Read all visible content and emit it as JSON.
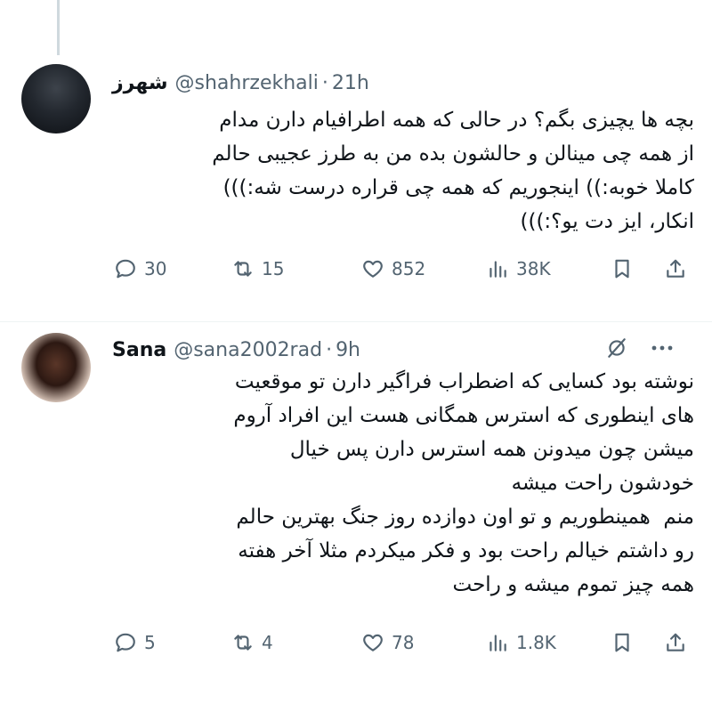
{
  "tweets": [
    {
      "name": "شهرز",
      "handle": "@shahrzekhali",
      "time": "21h",
      "text": "بچه ها یچیزی بگم؟ در حالی که همه اطرافیام دارن مدام\nاز همه چی مینالن و حالشون بده من به طرز عجیبی حالم\nکاملا خوبه:)) اینجوریم که همه چی قراره درست شه:)))\nانکار، ایز دت یو؟:)))",
      "replies": "30",
      "retweets": "15",
      "likes": "852",
      "views": "38K"
    },
    {
      "name": "Sana",
      "handle": "@sana2002rad",
      "time": "9h",
      "text": "نوشته بود کسایی که اضطراب فراگیر دارن تو موقعیت\nهای اینطوری که استرس همگانی هست این افراد آروم\nمیشن چون میدونن همه استرس دارن پس خیال\nخودشون راحت میشه\nمنم  همینطوریم و تو اون دوازده روز جنگ بهترین حالم\nرو داشتم خیالم راحت بود و فکر میکردم مثلا آخر هفته\nهمه چیز تموم میشه و راحت",
      "replies": "5",
      "retweets": "4",
      "likes": "78",
      "views": "1.8K"
    }
  ],
  "separator": "·",
  "icons": {
    "reply": "reply-icon",
    "retweet": "retweet-icon",
    "like": "heart-icon",
    "views": "views-icon",
    "bookmark": "bookmark-icon",
    "share": "share-icon",
    "more": "more-icon",
    "grok": "grok-icon"
  },
  "colors": {
    "text": "#0f1419",
    "muted": "#536471",
    "line": "#cfd9de"
  }
}
